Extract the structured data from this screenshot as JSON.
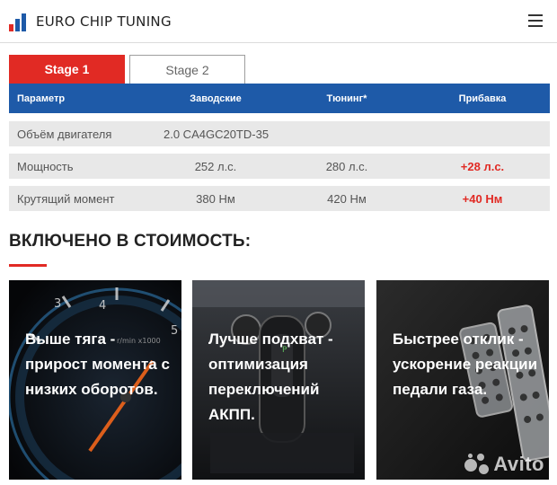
{
  "header": {
    "logo_text": "EURO CHIP TUNING",
    "menu_icon": "hamburger-menu-icon"
  },
  "tabs": [
    {
      "label": "Stage 1",
      "active": true
    },
    {
      "label": "Stage 2",
      "active": false
    }
  ],
  "table": {
    "headers": [
      "Параметр",
      "Заводские",
      "Тюнинг*",
      "Прибавка"
    ],
    "rows": [
      {
        "param": "Объём двигателя",
        "factory": "2.0 CA4GC20TD-35",
        "tuning": "",
        "gain": ""
      },
      {
        "param": "Мощность",
        "factory": "252 л.с.",
        "tuning": "280 л.с.",
        "gain": "+28 л.с."
      },
      {
        "param": "Крутящий момент",
        "factory": "380 Нм",
        "tuning": "420 Нм",
        "gain": "+40 Нм"
      }
    ]
  },
  "section": {
    "title": "ВКЛЮЧЕНО В СТОИМОСТЬ:"
  },
  "cards": [
    {
      "text": "Выше тяга - прирост момента с низких оборотов.",
      "image": "tachometer-gauge"
    },
    {
      "text": "Лучше подхват - оптимизация переключений АКПП.",
      "image": "automatic-gear-shifter"
    },
    {
      "text": "Быстрее отклик - ускорение реакции педали газа.",
      "image": "aluminum-car-pedals"
    }
  ],
  "watermark": {
    "text": "Avito"
  },
  "colors": {
    "accent_red": "#e12a24",
    "header_blue": "#1e5aa8",
    "row_gray": "#e8e8e8"
  }
}
